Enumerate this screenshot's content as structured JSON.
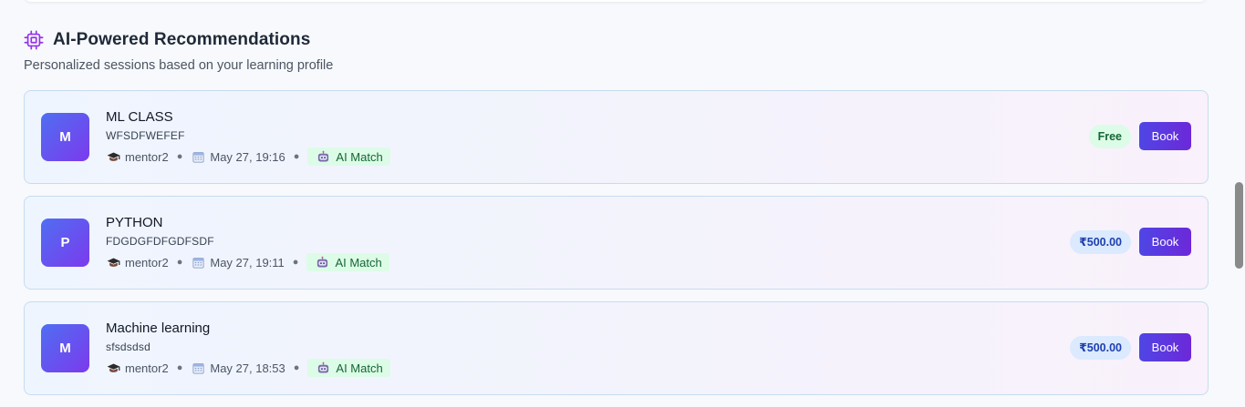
{
  "section": {
    "icon": "cpu-chip-icon",
    "title": "AI-Powered Recommendations",
    "subtitle": "Personalized sessions based on your learning profile"
  },
  "colors": {
    "accent": "#4f46e5",
    "accent_purple": "#7c3aed",
    "ai_badge_bg": "#dcfce7",
    "ai_badge_text": "#166534",
    "price_bg": "#dbeafe",
    "price_text": "#1e40af"
  },
  "cards": [
    {
      "initial": "M",
      "title": "ML CLASS",
      "description": "WFSDFWEFEF",
      "mentor": "mentor2",
      "date": "May 27, 19:16",
      "badge": "AI Match",
      "price": "Free",
      "price_type": "free",
      "action": "Book"
    },
    {
      "initial": "P",
      "title": "PYTHON",
      "description": "FDGDGFDFGDFSDF",
      "mentor": "mentor2",
      "date": "May 27, 19:11",
      "badge": "AI Match",
      "price": "₹500.00",
      "price_type": "paid",
      "action": "Book"
    },
    {
      "initial": "M",
      "title": "Machine learning",
      "description": "sfsdsdsd",
      "mentor": "mentor2",
      "date": "May 27, 18:53",
      "badge": "AI Match",
      "price": "₹500.00",
      "price_type": "paid",
      "action": "Book"
    }
  ]
}
